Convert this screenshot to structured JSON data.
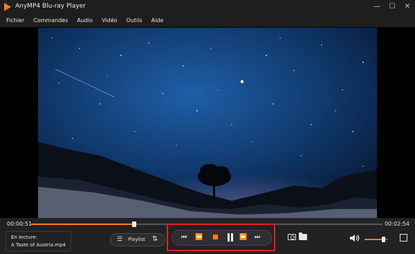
{
  "app": {
    "title": "AnyMP4 Blu-ray Player"
  },
  "window_controls": {
    "minimize": "—",
    "maximize": "☐",
    "close": "✕"
  },
  "menu": {
    "items": [
      "Fichier",
      "Commandes",
      "Audio",
      "Vidéo",
      "Outils",
      "Aide"
    ]
  },
  "playback": {
    "current_time": "00:00:51",
    "total_time": "00:02:54",
    "progress_fraction": 0.293,
    "volume_fraction": 0.8
  },
  "now_playing": {
    "label": "En lecture:",
    "file": "A Taste of Austria.mp4"
  },
  "playlist": {
    "label": "Playlist"
  },
  "icons": {
    "logo": "play-triangle-logo-icon",
    "prev": "skip-previous-icon",
    "rewind": "rewind-icon",
    "stop": "stop-icon",
    "pause": "pause-icon",
    "forward": "fast-forward-icon",
    "next": "skip-next-icon",
    "snapshot": "camera-icon",
    "folder": "folder-icon",
    "volume": "speaker-icon",
    "fullscreen": "fullscreen-icon"
  },
  "colors": {
    "accent": "#ff7f1f",
    "highlight_box": "#e0212b",
    "background": "#1b1b1b"
  }
}
